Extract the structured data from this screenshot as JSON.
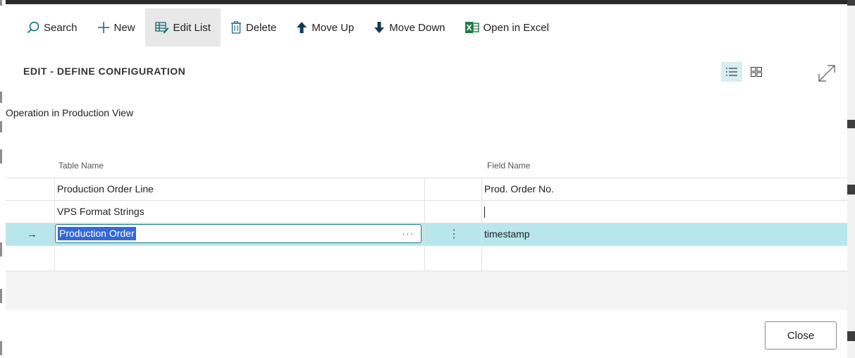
{
  "toolbar": {
    "search": "Search",
    "new": "New",
    "edit_list": "Edit List",
    "delete": "Delete",
    "move_up": "Move Up",
    "move_down": "Move Down",
    "open_excel": "Open in Excel"
  },
  "page": {
    "title": "EDIT - DEFINE CONFIGURATION",
    "section": "Operation in Production View"
  },
  "grid": {
    "columns": {
      "table_name": "Table Name",
      "field_name": "Field Name"
    },
    "rows": [
      {
        "table_name": "Production Order Line",
        "field_name": "Prod. Order No."
      },
      {
        "table_name": "VPS Format Strings",
        "field_name": ""
      },
      {
        "table_name": "Production Order",
        "field_name": "timestamp",
        "selected": true
      },
      {
        "table_name": "",
        "field_name": ""
      }
    ],
    "row_arrow": "→",
    "lookup": "···",
    "row_menu": "⋮"
  },
  "footer": {
    "close": "Close"
  },
  "colors": {
    "accent": "#1e7e8c",
    "selected_row": "#b9e6ec",
    "text_selection": "#3468d6"
  }
}
